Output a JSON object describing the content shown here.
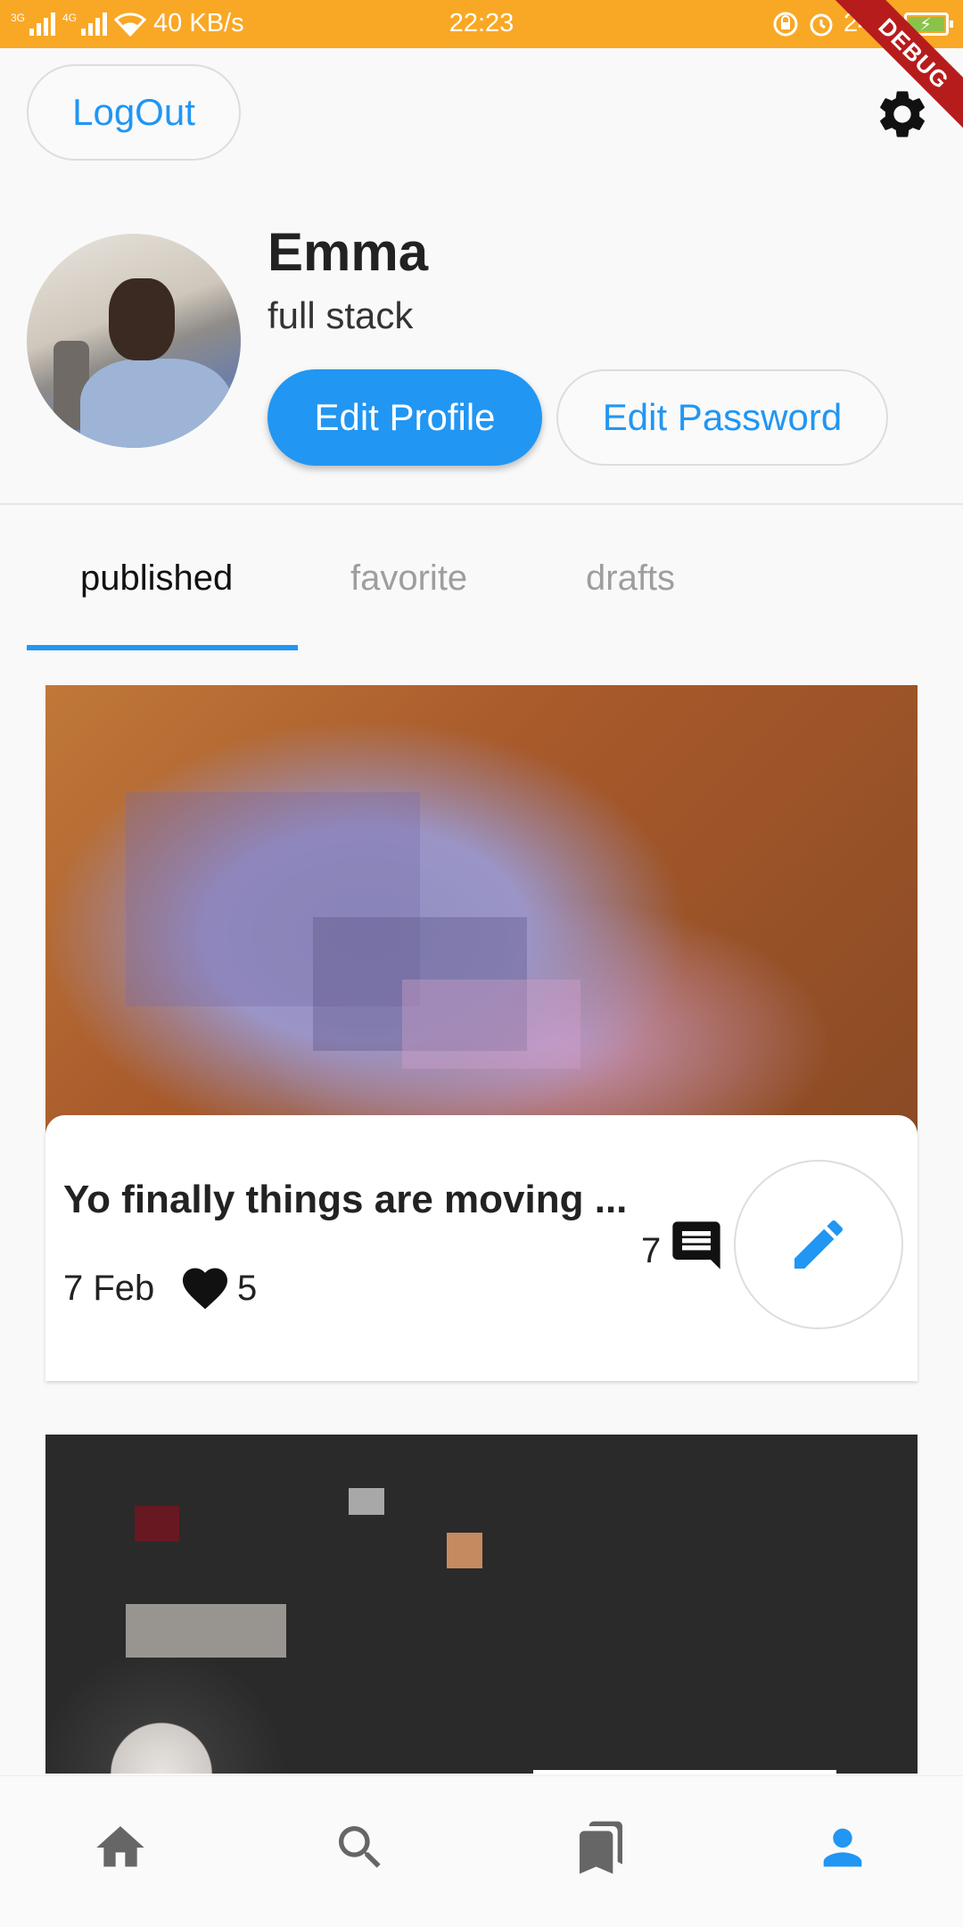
{
  "status_bar": {
    "network_type_1": "3G",
    "network_type_2": "4G",
    "speed": "40 KB/s",
    "time": "22:23",
    "battery": "24%",
    "battery_color": "#8bc34a"
  },
  "header": {
    "logout_label": "LogOut",
    "debug_label": "DEBUG",
    "settings_icon": "gear-icon"
  },
  "profile": {
    "name": "Emma",
    "role": "full stack",
    "edit_profile_label": "Edit Profile",
    "edit_password_label": "Edit Password",
    "accent_color": "#2196f3"
  },
  "tabs": [
    {
      "label": "published",
      "active": true
    },
    {
      "label": "favorite",
      "active": false
    },
    {
      "label": "drafts",
      "active": false
    }
  ],
  "posts": [
    {
      "title": "Yo finally things are moving ...",
      "date": "7 Feb",
      "likes": "5",
      "comments": "7"
    }
  ],
  "bottom_nav": [
    {
      "icon": "home-icon",
      "active": false
    },
    {
      "icon": "search-icon",
      "active": false
    },
    {
      "icon": "bookmarks-icon",
      "active": false
    },
    {
      "icon": "person-icon",
      "active": true
    }
  ]
}
